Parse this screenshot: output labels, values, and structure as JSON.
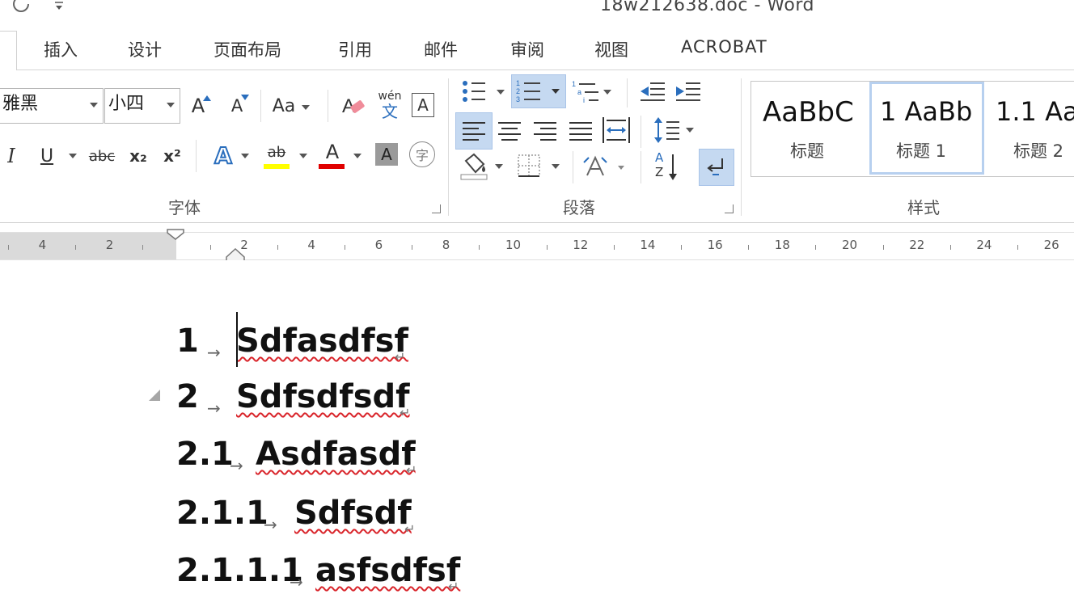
{
  "window": {
    "title": "18w212638.doc - Word"
  },
  "icons": {
    "qa_refresh": "refresh-icon",
    "qa_customize": "customize-quick-access-icon"
  },
  "tabs": [
    "插入",
    "设计",
    "页面布局",
    "引用",
    "邮件",
    "审阅",
    "视图",
    "ACROBAT"
  ],
  "font_group": {
    "font_name": "雅黑",
    "font_size": "小四",
    "grow_label": "A",
    "shrink_label": "A",
    "case_label": "Aa",
    "phonetic_top": "wén",
    "phonetic_bottom": "文",
    "border_char": "A",
    "italic": "I",
    "underline": "U",
    "strike": "abc",
    "subscript": "x₂",
    "superscript": "x²",
    "text_effect": "A",
    "highlight": "ab",
    "font_color": "A",
    "shading": "A",
    "enclose": "字",
    "label": "字体",
    "highlight_color": "#ffff00",
    "font_color_bar": "#e00000"
  },
  "paragraph_group": {
    "label": "段落",
    "sort_a": "A",
    "sort_z": "Z"
  },
  "styles_group": {
    "label": "样式",
    "items": [
      {
        "preview": "AaBbC",
        "name": "标题"
      },
      {
        "preview": "1  AaBb",
        "name": "标题 1"
      },
      {
        "preview": "1.1  Aa",
        "name": "标题 2"
      }
    ]
  },
  "ruler": {
    "left_ticks": [
      "4",
      "2"
    ],
    "right_ticks": [
      "2",
      "4",
      "6",
      "8",
      "10",
      "12",
      "14",
      "16",
      "18",
      "20",
      "22",
      "24",
      "26"
    ]
  },
  "document": {
    "paragraph_mark": "↵",
    "tab_arrow": "→",
    "headings": [
      {
        "number": "1",
        "text": "Sdfasdfsf"
      },
      {
        "number": "2",
        "text": "Sdfsdfsdf"
      },
      {
        "number": "2.1",
        "text": "Asdfasdf"
      },
      {
        "number": "2.1.1",
        "text": "Sdfsdf"
      },
      {
        "number": "2.1.1.1",
        "text": "asfsdfsf"
      }
    ]
  }
}
